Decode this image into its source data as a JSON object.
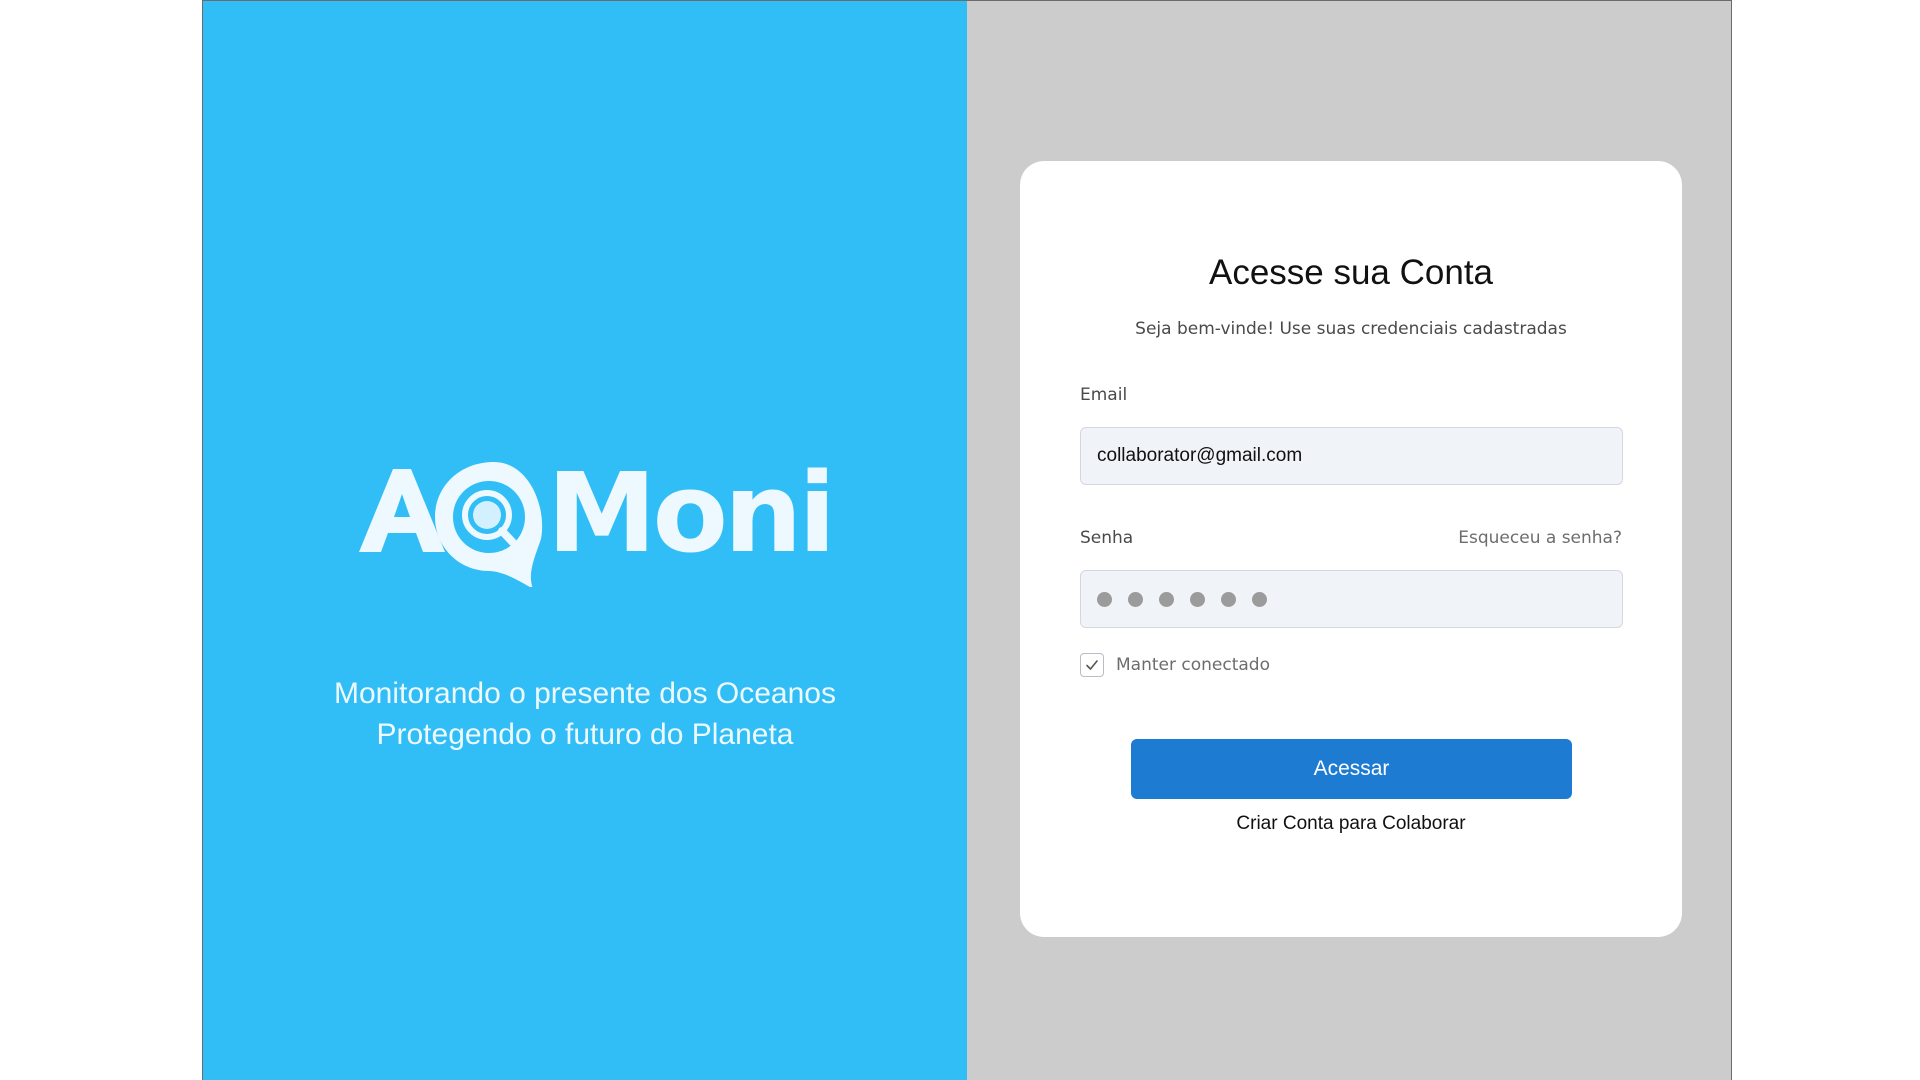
{
  "brand": {
    "logo_text": "AQMoni",
    "tagline_line1": "Monitorando o presente dos Oceanos",
    "tagline_line2": "Protegendo o futuro do Planeta",
    "logo_color": "#eef9ff",
    "panel_color": "#31bdf6"
  },
  "login": {
    "title": "Acesse sua Conta",
    "subtitle": "Seja bem-vinde! Use suas credenciais cadastradas",
    "email_label": "Email",
    "email_value": "collaborator@gmail.com",
    "password_label": "Senha",
    "forgot_password": "Esqueceu a senha?",
    "password_mask_length": 6,
    "remember_label": "Manter conectado",
    "remember_checked": true,
    "submit_label": "Acessar",
    "create_account": "Criar Conta para Colaborar",
    "accent_color": "#1e7bd2"
  }
}
